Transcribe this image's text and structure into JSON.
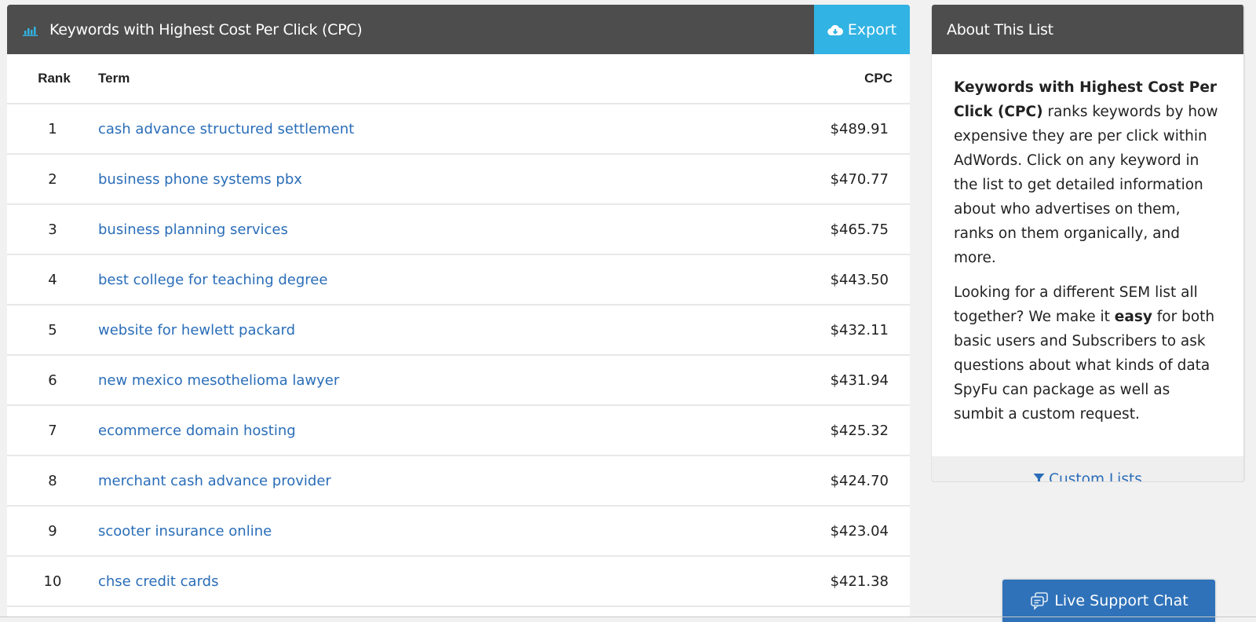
{
  "main": {
    "title": "Keywords with Highest Cost Per Click (CPC)",
    "title_icon": "bar-chart-icon",
    "export_label": "Export",
    "export_icon": "cloud-download-icon",
    "columns": {
      "rank": "Rank",
      "term": "Term",
      "cpc": "CPC"
    },
    "rows": [
      {
        "rank": "1",
        "term": "cash advance structured settlement",
        "cpc": "$489.91"
      },
      {
        "rank": "2",
        "term": "business phone systems pbx",
        "cpc": "$470.77"
      },
      {
        "rank": "3",
        "term": "business planning services",
        "cpc": "$465.75"
      },
      {
        "rank": "4",
        "term": "best college for teaching degree",
        "cpc": "$443.50"
      },
      {
        "rank": "5",
        "term": "website for hewlett packard",
        "cpc": "$432.11"
      },
      {
        "rank": "6",
        "term": "new mexico mesothelioma lawyer",
        "cpc": "$431.94"
      },
      {
        "rank": "7",
        "term": "ecommerce domain hosting",
        "cpc": "$425.32"
      },
      {
        "rank": "8",
        "term": "merchant cash advance provider",
        "cpc": "$424.70"
      },
      {
        "rank": "9",
        "term": "scooter insurance online",
        "cpc": "$423.04"
      },
      {
        "rank": "10",
        "term": "chse credit cards",
        "cpc": "$421.38"
      }
    ]
  },
  "sidebar": {
    "title": "About This List",
    "p1_bold": "Keywords with Highest Cost Per Click (CPC)",
    "p1_rest": " ranks keywords by how expensive they are per click within AdWords. Click on any keyword in the list to get detailed information about who advertises on them, ranks on them organically, and more.",
    "p2_before": "Looking for a different SEM list all together? We make it ",
    "p2_bold": "easy",
    "p2_after": " for both basic users and Subscribers to ask questions about what kinds of data SpyFu can package as well as sumbit a custom request.",
    "custom_lists_label": "Custom Lists",
    "custom_lists_icon": "filter-icon"
  },
  "chat": {
    "label": "Live Support Chat",
    "icon": "chat-bubbles-icon"
  },
  "colors": {
    "header_bg": "#4d4d4d",
    "export_bg": "#31b3e3",
    "link": "#2a6db8",
    "chat_bg": "#2f72b9",
    "page_bg": "#f1f1f1"
  }
}
